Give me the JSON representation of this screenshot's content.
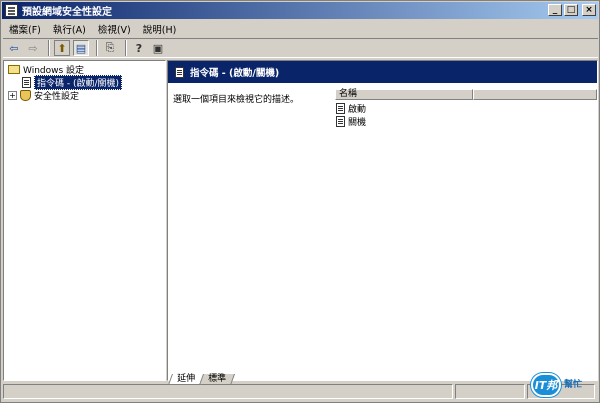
{
  "window": {
    "title": "預設網域安全性設定"
  },
  "title_buttons": {
    "minimize": "_",
    "maximize": "□",
    "close": "×"
  },
  "menu": {
    "items": [
      {
        "label": "檔案(F)"
      },
      {
        "label": "執行(A)"
      },
      {
        "label": "檢視(V)"
      },
      {
        "label": "說明(H)"
      }
    ]
  },
  "toolbar": {
    "icons": [
      "back-arrow-icon",
      "forward-arrow-icon",
      "up-folder-icon",
      "show-hide-tree-icon",
      "export-list-icon",
      "help-icon",
      "properties-icon"
    ],
    "glyphs": {
      "back": "⇦",
      "forward": "⇨",
      "up": "⬆",
      "tree": "▤",
      "export": "⎘",
      "help": "?",
      "props": "▣"
    }
  },
  "tree": {
    "root": {
      "label": "Windows 設定"
    },
    "selected_item": {
      "label": "指令碼 - (啟動/關機)"
    },
    "security": {
      "label": "安全性設定",
      "expand": "+"
    }
  },
  "details": {
    "banner_title": "指令碼 - (啟動/關機)",
    "description": "選取一個項目來檢視它的描述。",
    "columns": [
      {
        "label": "名稱"
      },
      {
        "label": ""
      }
    ],
    "rows": [
      {
        "name": "啟動"
      },
      {
        "name": "關機"
      }
    ]
  },
  "tabs": [
    {
      "label": "延伸"
    },
    {
      "label": "標準"
    }
  ],
  "watermark": {
    "badge": "IT邦",
    "text1": "幫忙"
  },
  "colors": {
    "title_start": "#0a246a",
    "title_end": "#a6caf0",
    "selection": "#0a246a",
    "chrome": "#d4d0c8"
  }
}
